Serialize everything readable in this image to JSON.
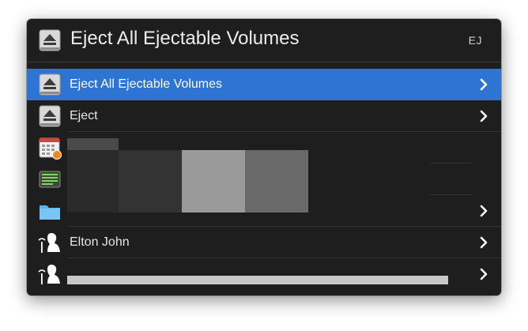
{
  "search": {
    "query": "Eject All Ejectable Volumes",
    "abbreviation": "EJ",
    "icon": "eject-disk-icon"
  },
  "results": [
    {
      "label": "Eject All Ejectable Volumes",
      "icon": "eject-disk-icon",
      "selected": true
    },
    {
      "label": "Eject",
      "icon": "eject-disk-icon",
      "selected": false
    },
    {
      "label": "",
      "icon": "calendar-icon",
      "selected": false
    },
    {
      "label": "",
      "icon": "terminal-icon",
      "selected": false
    },
    {
      "label": "",
      "icon": "folder-icon",
      "selected": false
    },
    {
      "label": "Elton John",
      "icon": "artist-icon",
      "selected": false
    },
    {
      "label": "",
      "icon": "artist-icon",
      "selected": false
    }
  ],
  "colors": {
    "panel": "#1e1e1e",
    "selection": "#2d74d3",
    "text": "#e6e6e6"
  }
}
